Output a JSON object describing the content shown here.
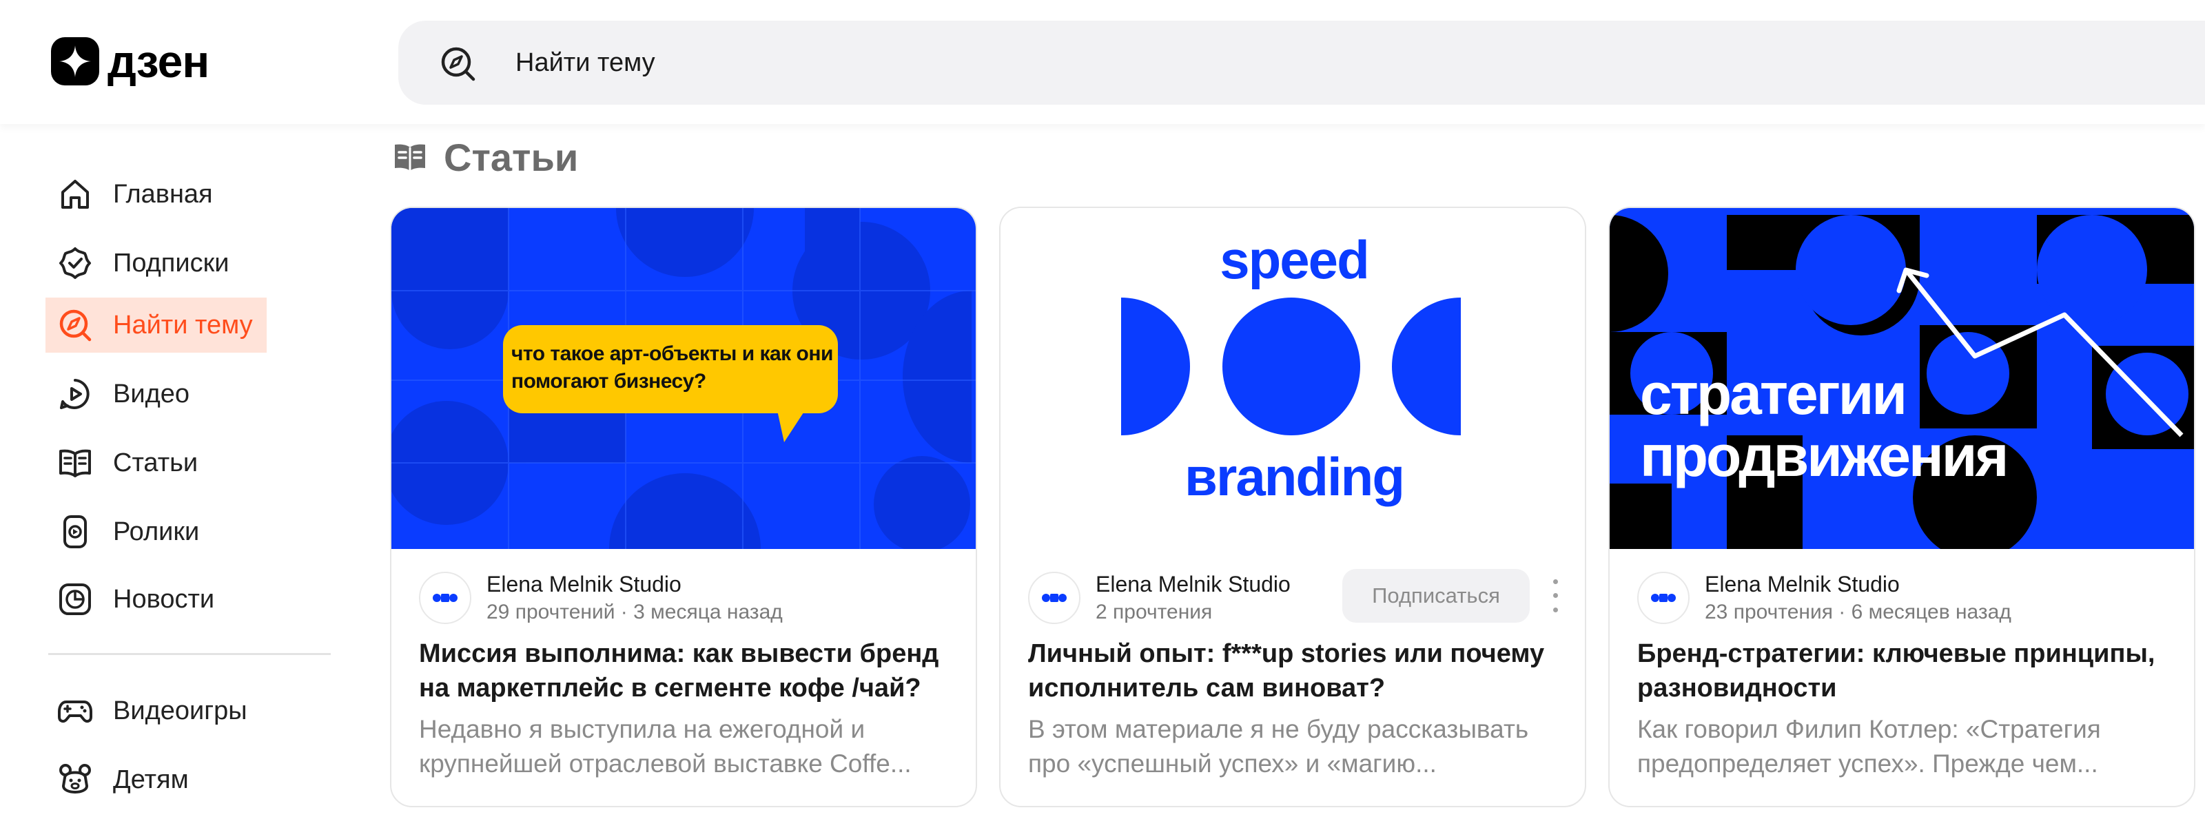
{
  "header": {
    "logo_text": "дзен",
    "search": {
      "placeholder": "Найти тему",
      "value": ""
    }
  },
  "sidebar": {
    "items": [
      {
        "label": "Главная",
        "icon": "home-icon"
      },
      {
        "label": "Подписки",
        "icon": "subscriptions-icon"
      },
      {
        "label": "Найти тему",
        "icon": "compass-icon",
        "active": true
      },
      {
        "label": "Видео",
        "icon": "video-icon"
      },
      {
        "label": "Статьи",
        "icon": "articles-icon"
      },
      {
        "label": "Ролики",
        "icon": "shorts-icon"
      },
      {
        "label": "Новости",
        "icon": "news-icon"
      },
      {
        "label": "Видеоигры",
        "icon": "gamepad-icon"
      },
      {
        "label": "Детям",
        "icon": "kids-icon"
      }
    ]
  },
  "section": {
    "title": "Статьи",
    "icon": "articles-icon"
  },
  "cards": [
    {
      "image_text": "что такое арт-объекты и как они помогают бизнесу?",
      "author": "Elena Melnik Studio",
      "meta": "29 прочтений · 3 месяца назад",
      "title": "Миссия выполнима: как вывести бренд на маркетплейс в сегменте кофе /чай?",
      "desc": "Недавно я выступила на ежегодной и крупнейшей отраслевой выставке Coffe..."
    },
    {
      "image_text_top": "speed",
      "image_text_bottom": "вranding",
      "author": "Elena Melnik Studio",
      "meta": "2 прочтения",
      "subscribe_label": "Подписаться",
      "title": "Личный опыт: f***up stories или почему исполнитель сам виноват?",
      "desc": "В этом материале я не буду рассказывать про «успешный успех» и «магию..."
    },
    {
      "image_text": "стратегии продвижения",
      "author": "Elena Melnik Studio",
      "meta": "23 прочтения · 6 месяцев назад",
      "title": "Бренд-стратегии: ключевые принципы, разновидности",
      "desc": "Как говорил Филип Котлер: «Стратегия предопределяет успех». Прежде чем..."
    }
  ],
  "colors": {
    "accent": "#ff4d1c",
    "accent_bg": "#ffe3d9",
    "brand_blue": "#0a3cff",
    "bubble_yellow": "#ffc800"
  }
}
